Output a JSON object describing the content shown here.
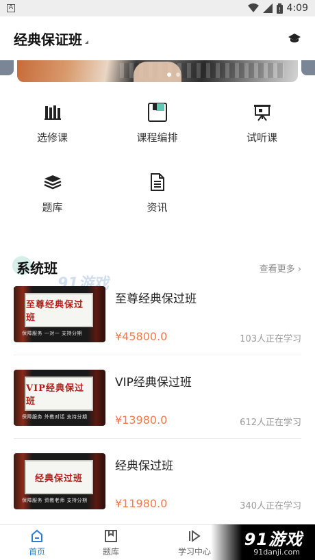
{
  "statusbar": {
    "time": "4:09",
    "left_glyph": "A"
  },
  "header": {
    "title": "经典保证班"
  },
  "banner": {
    "dots": 2,
    "active_dot": 0
  },
  "grid": {
    "items": [
      {
        "label": "选修课",
        "icon": "books-icon"
      },
      {
        "label": "课程编排",
        "icon": "schedule-icon"
      },
      {
        "label": "试听课",
        "icon": "presentation-icon"
      },
      {
        "label": "题库",
        "icon": "stack-icon"
      },
      {
        "label": "资讯",
        "icon": "document-icon"
      }
    ]
  },
  "section": {
    "title": "系统班",
    "more": "查看更多 ›"
  },
  "watermark_top": "91游戏",
  "courses": [
    {
      "name": "至尊经典保过班",
      "price": "¥45800.0",
      "learners": "103人正在学习",
      "thumb_title": "至尊经典保过班",
      "thumb_sub": "保障服务 一对一 支持分期"
    },
    {
      "name": "VIP经典保过班",
      "price": "¥13980.0",
      "learners": "612人正在学习",
      "thumb_title": "VIP经典保过班",
      "thumb_sub": "保障服务 外教对话 支持分期"
    },
    {
      "name": "经典保过班",
      "price": "¥11980.0",
      "learners": "340人正在学习",
      "thumb_title": "经典保过班",
      "thumb_sub": "保障服务 资教老师 支持分期"
    }
  ],
  "tabbar": {
    "tabs": [
      {
        "label": "首页",
        "icon": "home-icon",
        "active": true
      },
      {
        "label": "题库",
        "icon": "bookmark-icon",
        "active": false
      },
      {
        "label": "学习中心",
        "icon": "play-icon",
        "active": false
      }
    ]
  },
  "watermark_bottom": {
    "brand": "91游戏",
    "domain": "91danji.com"
  },
  "colors": {
    "accent": "#2a7ed6",
    "price": "#ef7a4a"
  }
}
